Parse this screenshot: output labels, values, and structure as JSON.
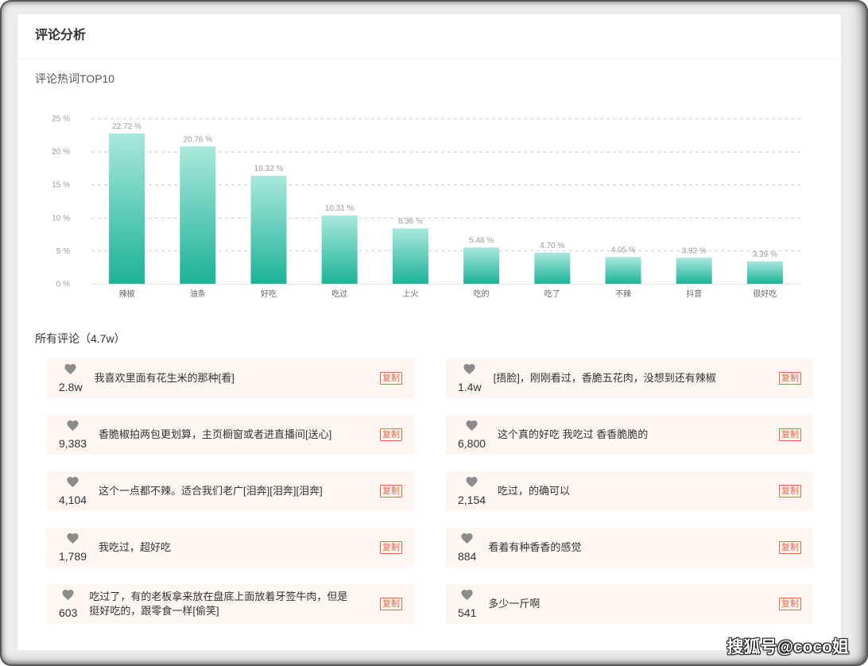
{
  "header": {
    "title": "评论分析"
  },
  "chart_data": {
    "type": "bar",
    "title": "评论热词TOP10",
    "categories": [
      "辣椒",
      "油条",
      "好吃",
      "吃过",
      "上火",
      "吃的",
      "吃了",
      "不辣",
      "抖音",
      "很好吃"
    ],
    "values": [
      22.72,
      20.76,
      16.32,
      10.31,
      8.36,
      5.48,
      4.7,
      4.05,
      3.92,
      3.39
    ],
    "data_labels": [
      "22.72 %",
      "20.76 %",
      "16.32 %",
      "10.31 %",
      "8.36 %",
      "5.48 %",
      "4.70 %",
      "4.05 %",
      "3.92 %",
      "3.39 %"
    ],
    "yticks": [
      0,
      5,
      10,
      15,
      20,
      25
    ],
    "ytick_labels": [
      "0 %",
      "5 %",
      "10 %",
      "15 %",
      "20 %",
      "25 %"
    ],
    "ylim": [
      0,
      25
    ],
    "grid": true,
    "colors": {
      "bar_top": "#a9e8dd",
      "bar_bottom": "#1db396"
    }
  },
  "comments": {
    "title": "所有评论（4.7w）",
    "copy_label": "复制",
    "like_icon": "heart-icon",
    "items": [
      {
        "likes": "2.8w",
        "text": "我喜欢里面有花生米的那种[看]"
      },
      {
        "likes": "1.4w",
        "text": "[捂脸]，刚刚看过，香脆五花肉，没想到还有辣椒"
      },
      {
        "likes": "9,383",
        "text": "香脆椒拍两包更划算，主页橱窗或者进直播间[送心]"
      },
      {
        "likes": "6,800",
        "text": "这个真的好吃 我吃过 香香脆脆的"
      },
      {
        "likes": "4,104",
        "text": "这个一点都不辣。适合我们老广[泪奔][泪奔][泪奔]"
      },
      {
        "likes": "2,154",
        "text": "吃过，的确可以"
      },
      {
        "likes": "1,789",
        "text": "我吃过，超好吃"
      },
      {
        "likes": "884",
        "text": "看着有种香香的感觉"
      },
      {
        "likes": "603",
        "text": "吃过了，有的老板拿来放在盘底上面放着牙签牛肉，但是挺好吃的，跟零食一样[偷笑]"
      },
      {
        "likes": "541",
        "text": "多少一斤啊"
      }
    ]
  },
  "theme": {
    "copy_button": "#e8684a",
    "comment_card_bg": "#fff5f1",
    "like_icon": "#8c8c8c"
  },
  "watermark": "搜狐号@coco姐"
}
